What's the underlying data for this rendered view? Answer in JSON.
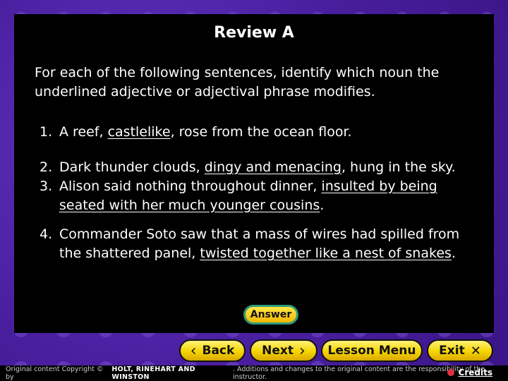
{
  "slide": {
    "title": "Review A",
    "intro": "For each of the following sentences, identify which noun the underlined adjective or adjectival phrase modifies.",
    "items": [
      {
        "num": "1.",
        "segments": [
          {
            "t": "A reef, "
          },
          {
            "t": "castlelike",
            "u": true
          },
          {
            "t": ", rose from the ocean floor."
          }
        ]
      },
      {
        "num": "2.",
        "segments": [
          {
            "t": "Dark thunder clouds, "
          },
          {
            "t": "dingy and menacing",
            "u": true
          },
          {
            "t": ", hung in the sky."
          }
        ]
      },
      {
        "num": "3.",
        "segments": [
          {
            "t": "Alison said nothing throughout dinner, "
          },
          {
            "t": "insulted by being seated with her much younger cousins",
            "u": true
          },
          {
            "t": "."
          }
        ]
      },
      {
        "num": "4.",
        "segments": [
          {
            "t": "Commander Soto saw that a mass of wires had spilled from the shattered panel, "
          },
          {
            "t": "twisted together like a nest of snakes",
            "u": true
          },
          {
            "t": "."
          }
        ]
      }
    ],
    "answer_label": "Answer"
  },
  "nav": {
    "back": "Back",
    "next": "Next",
    "lesson_menu": "Lesson Menu",
    "exit": "Exit"
  },
  "footer": {
    "prefix": "Original content Copyright © by",
    "publisher": "HOLT, RINEHART AND WINSTON",
    "suffix": ". Additions and changes to the original content are the responsibility of the instructor.",
    "credits": "Credits"
  },
  "colors": {
    "panel": "#000000",
    "background": "#4a1fa0",
    "button": "#f5d400",
    "answer_border": "#2f9a7a",
    "credits_dot": "#e03040"
  }
}
